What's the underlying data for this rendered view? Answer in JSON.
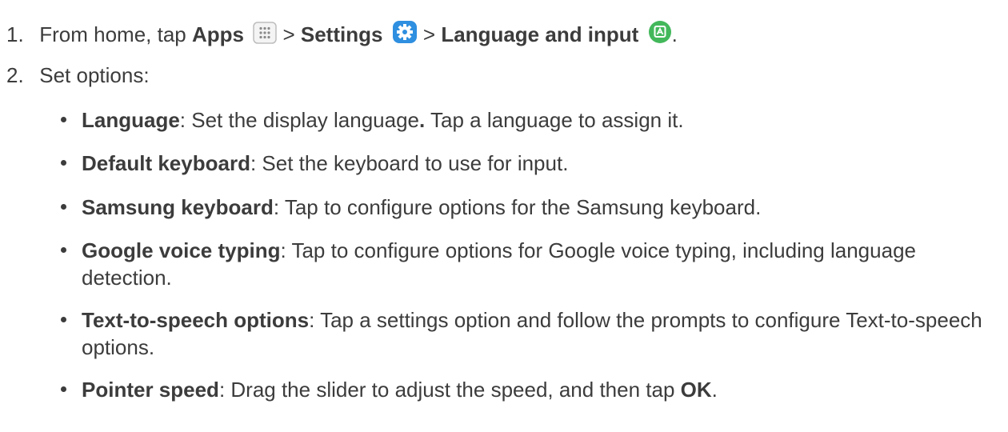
{
  "steps": [
    {
      "number": "1.",
      "parts": {
        "lead": "From home, tap",
        "apps": "Apps",
        "sep1": ">",
        "settings": "Settings",
        "sep2": ">",
        "language_input": "Language and input",
        "end": "."
      }
    },
    {
      "number": "2.",
      "text": "Set options:"
    }
  ],
  "options": [
    {
      "term": "Language",
      "desc": ": Set the display language",
      "desc_bold": ".",
      "desc_tail": " Tap a language to assign it."
    },
    {
      "term": "Default keyboard",
      "desc": ": Set the keyboard to use for input."
    },
    {
      "term": "Samsung keyboard",
      "desc": ": Tap to configure options for the Samsung keyboard."
    },
    {
      "term": "Google voice typing",
      "desc": ": Tap to configure options for Google voice typing, including language detection."
    },
    {
      "term": "Text-to-speech options",
      "desc": ": Tap a settings option and follow the prompts to configure Text-to-speech options."
    },
    {
      "term": "Pointer speed",
      "desc": ": Drag the slider to adjust the speed, and then tap ",
      "desc_bold": "OK",
      "desc_tail": "."
    }
  ],
  "icons": {
    "apps": "apps-grid-icon",
    "settings": "settings-gear-icon",
    "language": "language-input-icon"
  },
  "colors": {
    "text": "#3c3c3c",
    "settings_icon": "#2f8fe0",
    "language_icon": "#43b85b"
  }
}
